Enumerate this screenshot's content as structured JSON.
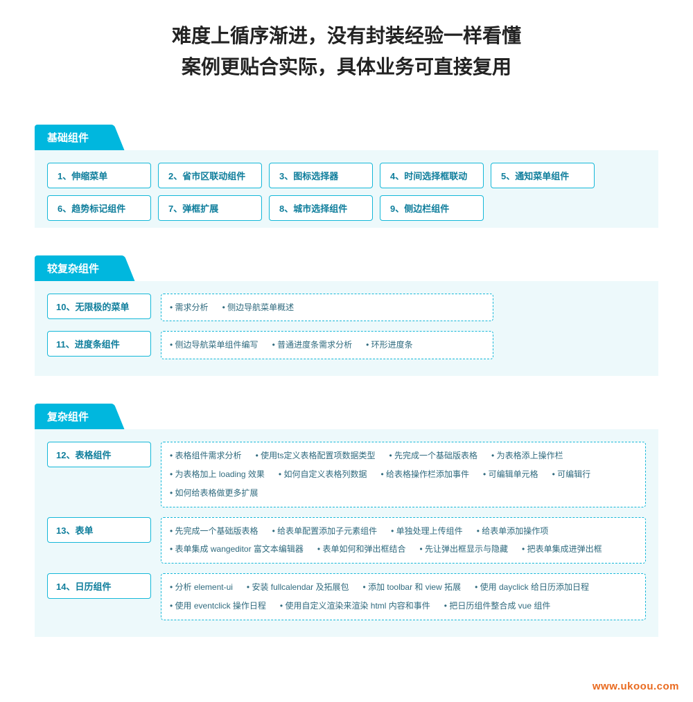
{
  "headline_line1": "难度上循序渐进，没有封装经验一样看懂",
  "headline_line2": "案例更贴合实际，具体业务可直接复用",
  "watermark": "www.ukoou.com",
  "sections": {
    "basic": {
      "title": "基础组件",
      "items": [
        "1、伸缩菜单",
        "2、省市区联动组件",
        "3、图标选择器",
        "4、时间选择框联动",
        "5、通知菜单组件",
        "6、趋势标记组件",
        "7、弹框扩展",
        "8、城市选择组件",
        "9、侧边栏组件"
      ]
    },
    "mid": {
      "title": "较复杂组件",
      "rows": [
        {
          "label": "10、无限极的菜单",
          "points": [
            "需求分析",
            "侧边导航菜单概述"
          ]
        },
        {
          "label": "11、进度条组件",
          "points": [
            "侧边导航菜单组件编写",
            "普通进度条需求分析",
            "环形进度条"
          ]
        }
      ]
    },
    "complex": {
      "title": "复杂组件",
      "rows": [
        {
          "label": "12、表格组件",
          "points": [
            "表格组件需求分析",
            "使用ts定义表格配置项数据类型",
            "先完成一个基础版表格",
            "为表格添上操作栏",
            "为表格加上 loading 效果",
            "如何自定义表格列数据",
            "给表格操作栏添加事件",
            "可编辑单元格",
            "可编辑行",
            "如何给表格做更多扩展"
          ]
        },
        {
          "label": "13、表单",
          "points": [
            "先完成一个基础版表格",
            "给表单配置添加子元素组件",
            "单独处理上传组件",
            "给表单添加操作项",
            "表单集成 wangeditor 富文本编辑器",
            "表单如何和弹出框结合",
            "先让弹出框显示与隐藏",
            "把表单集成进弹出框"
          ]
        },
        {
          "label": "14、日历组件",
          "points": [
            "分析 element-ui",
            "安装 fullcalendar 及拓展包",
            "添加 toolbar 和 view 拓展",
            "使用 dayclick 给日历添加日程",
            "使用 eventclick 操作日程",
            "使用自定义渲染来渲染 html 内容和事件",
            "把日历组件整合成 vue 组件"
          ]
        }
      ]
    }
  }
}
